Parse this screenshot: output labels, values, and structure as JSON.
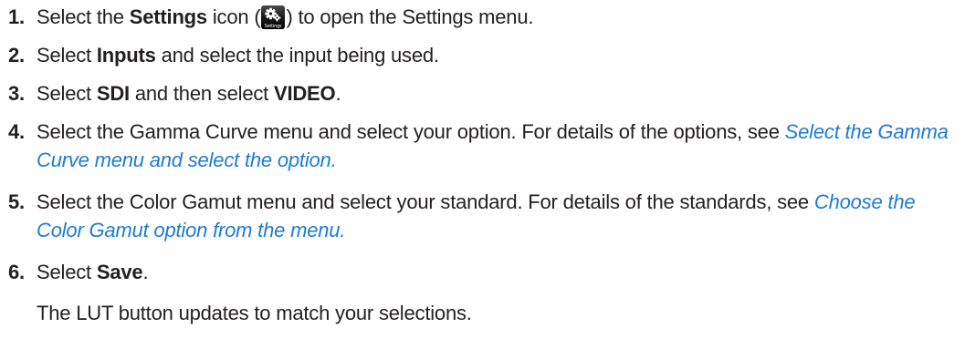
{
  "steps": [
    {
      "number": "1.",
      "t1": "Select the ",
      "b1": "Settings",
      "t2": " icon (",
      "icon": "settings-gear-icon",
      "icon_label": "Settings",
      "t3": ") to open the Settings menu."
    },
    {
      "number": "2.",
      "t1": "Select ",
      "b1": "Inputs",
      "t2": " and select the input being used."
    },
    {
      "number": "3.",
      "t1": "Select ",
      "b1": "SDI",
      "t2": " and then select ",
      "b2": "VIDEO",
      "t3": "."
    },
    {
      "number": "4.",
      "t1": "Select the Gamma Curve menu and select your option. For details of the options, see ",
      "link": "Select the Gamma Curve menu and select the option."
    },
    {
      "number": "5.",
      "t1": "Select the Color Gamut menu and select your standard. For details of the standards, see ",
      "link": "Choose the Color Gamut option from the menu."
    },
    {
      "number": "6.",
      "t1": "Select ",
      "b1": "Save",
      "t2": "."
    }
  ],
  "result": "The LUT button updates to match your selections.",
  "colors": {
    "text": "#231f20",
    "link": "#1e7bd6"
  }
}
